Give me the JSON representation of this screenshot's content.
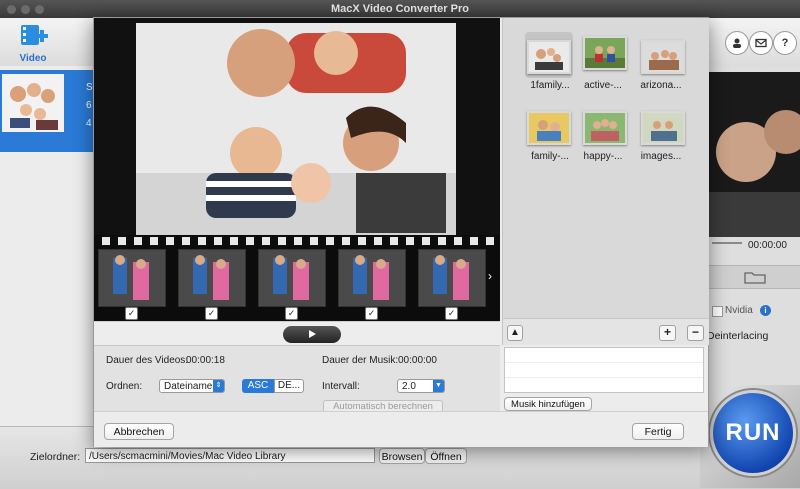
{
  "app": {
    "title": "MacX Video Converter Pro"
  },
  "toolbar": {
    "video_label": "Video"
  },
  "left": {
    "info_lines": [
      "S",
      "6",
      "4"
    ]
  },
  "right": {
    "time": "00:00:00",
    "nvidia_label": "Nvidia",
    "deinterlace_label": "Deinterlacing",
    "run_label": "RUN"
  },
  "bottom": {
    "folder_label": "Zielordner:",
    "folder_path": "/Users/scmacmini/Movies/Mac Video Library",
    "browse_label": "Browsen",
    "open_label": "Öffnen"
  },
  "dialog": {
    "video_duration_label": "Dauer des Videos:",
    "video_duration_value": "00:00:18",
    "music_duration_label": "Dauer der Musik:",
    "music_duration_value": "00:00:00",
    "sort_label": "Ordnen:",
    "sort_value": "Dateiname",
    "asc_label": "ASC",
    "desc_label": "DE...",
    "interval_label": "Intervall:",
    "interval_value": "2.0",
    "auto_calc_label": "Automatisch berechnen",
    "add_music_label": "Musik hinzufügen",
    "cancel_label": "Abbrechen",
    "done_label": "Fertig",
    "plus_label": "+",
    "minus_label": "−",
    "thumbnails": [
      {
        "label": "1family..."
      },
      {
        "label": "active-..."
      },
      {
        "label": "arizona..."
      },
      {
        "label": "family-..."
      },
      {
        "label": "happy-..."
      },
      {
        "label": "images..."
      }
    ]
  }
}
